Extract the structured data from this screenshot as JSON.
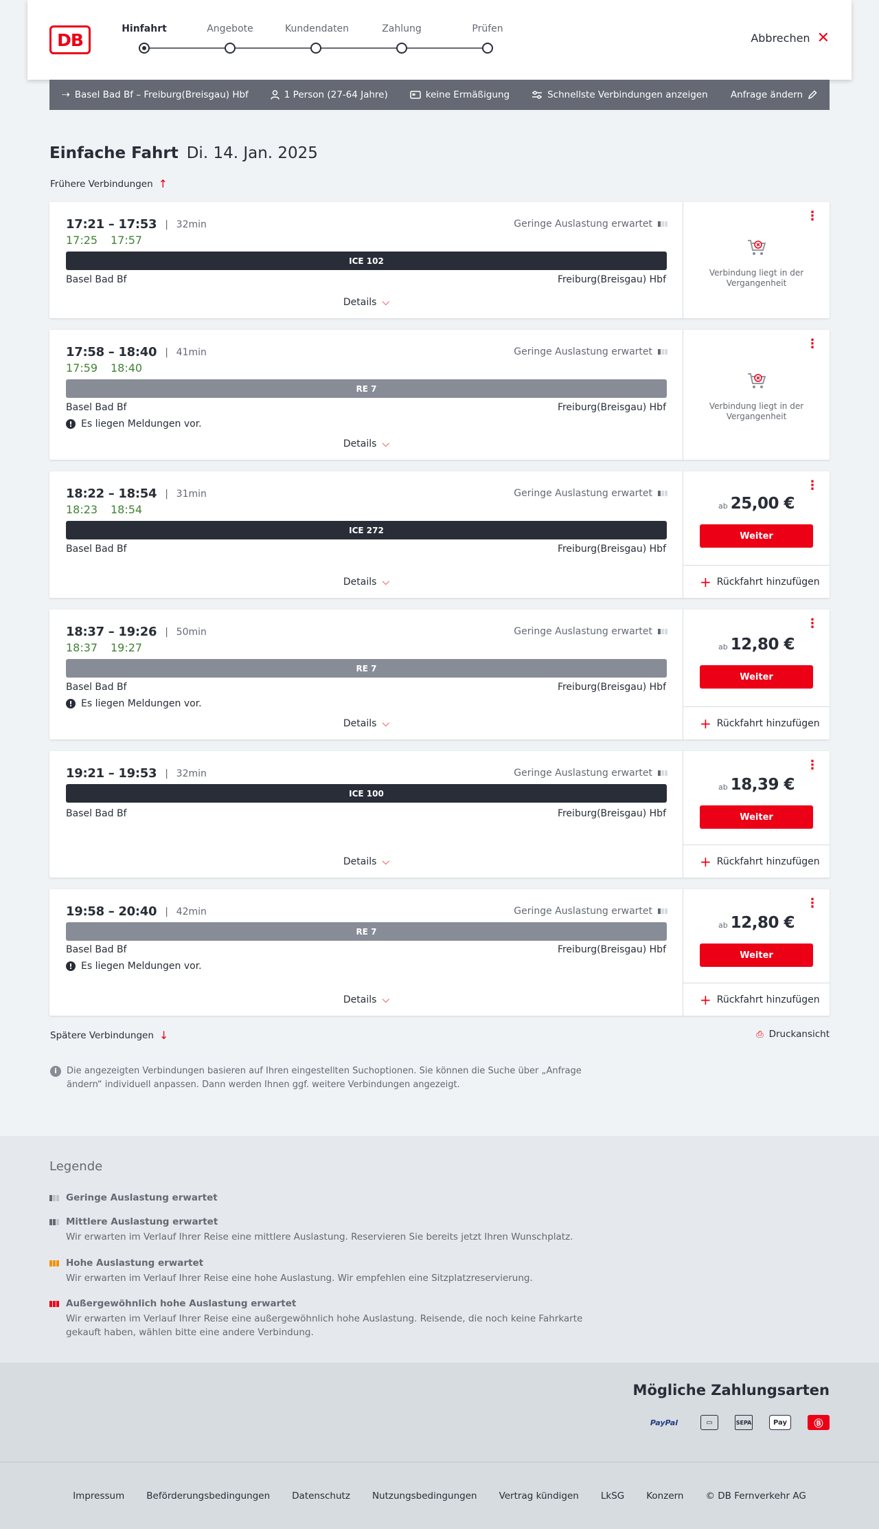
{
  "header": {
    "logo_text": "DB",
    "steps": [
      "Hinfahrt",
      "Angebote",
      "Kundendaten",
      "Zahlung",
      "Prüfen"
    ],
    "active_step": "Hinfahrt",
    "cancel_label": "Abbrechen"
  },
  "query_bar": {
    "route": "Basel Bad Bf – Freiburg(Breisgau) Hbf",
    "passengers": "1 Person (27-64 Jahre)",
    "discount": "keine Ermäßigung",
    "fastest": "Schnellste Verbindungen anzeigen",
    "change_label": "Anfrage ändern"
  },
  "title": {
    "type": "Einfache Fahrt",
    "date": "Di. 14. Jan. 2025"
  },
  "earlier_label": "Frühere Verbindungen",
  "later_label": "Spätere Verbindungen",
  "print_label": "Druckansicht",
  "connections": [
    {
      "times": "17:21 – 17:53",
      "duration": "32min",
      "rt_dep": "17:25",
      "rt_arr": "17:57",
      "train": "ICE 102",
      "train_type": "ice",
      "from": "Basel Bad Bf",
      "to": "Freiburg(Breisgau) Hbf",
      "load": "Geringe Auslastung erwartet",
      "message": "",
      "details": "Details",
      "past": "Verbindung liegt in der Vergangenheit"
    },
    {
      "times": "17:58 – 18:40",
      "duration": "41min",
      "rt_dep": "17:59",
      "rt_arr": "18:40",
      "train": "RE 7",
      "train_type": "re",
      "from": "Basel Bad Bf",
      "to": "Freiburg(Breisgau) Hbf",
      "load": "Geringe Auslastung erwartet",
      "message": "Es liegen Meldungen vor.",
      "details": "Details",
      "past": "Verbindung liegt in der Vergangenheit"
    },
    {
      "times": "18:22 – 18:54",
      "duration": "31min",
      "rt_dep": "18:23",
      "rt_arr": "18:54",
      "train": "ICE 272",
      "train_type": "ice",
      "from": "Basel Bad Bf",
      "to": "Freiburg(Breisgau) Hbf",
      "load": "Geringe Auslastung erwartet",
      "message": "",
      "details": "Details",
      "price_prefix": "ab",
      "price": "25,00 €",
      "button": "Weiter",
      "return_label": "Rückfahrt hinzufügen"
    },
    {
      "times": "18:37 – 19:26",
      "duration": "50min",
      "rt_dep": "18:37",
      "rt_arr": "19:27",
      "train": "RE 7",
      "train_type": "re",
      "from": "Basel Bad Bf",
      "to": "Freiburg(Breisgau) Hbf",
      "load": "Geringe Auslastung erwartet",
      "message": "Es liegen Meldungen vor.",
      "details": "Details",
      "price_prefix": "ab",
      "price": "12,80 €",
      "button": "Weiter",
      "return_label": "Rückfahrt hinzufügen"
    },
    {
      "times": "19:21 – 19:53",
      "duration": "32min",
      "train": "ICE 100",
      "train_type": "ice",
      "from": "Basel Bad Bf",
      "to": "Freiburg(Breisgau) Hbf",
      "load": "Geringe Auslastung erwartet",
      "message": "",
      "details": "Details",
      "price_prefix": "ab",
      "price": "18,39 €",
      "button": "Weiter",
      "return_label": "Rückfahrt hinzufügen"
    },
    {
      "times": "19:58 – 20:40",
      "duration": "42min",
      "train": "RE 7",
      "train_type": "re",
      "from": "Basel Bad Bf",
      "to": "Freiburg(Breisgau) Hbf",
      "load": "Geringe Auslastung erwartet",
      "message": "Es liegen Meldungen vor.",
      "details": "Details",
      "price_prefix": "ab",
      "price": "12,80 €",
      "button": "Weiter",
      "return_label": "Rückfahrt hinzufügen"
    }
  ],
  "info_text": "Die angezeigten Verbindungen basieren auf Ihren eingestellten Suchoptionen. Sie können die Suche über „Anfrage ändern“ individuell anpassen. Dann werden Ihnen ggf. weitere Verbindungen angezeigt.",
  "legend": {
    "title": "Legende",
    "items": [
      {
        "label": "Geringe Auslastung erwartet",
        "desc": ""
      },
      {
        "label": "Mittlere Auslastung erwartet",
        "desc": "Wir erwarten im Verlauf Ihrer Reise eine mittlere Auslastung. Reservieren Sie bereits jetzt Ihren Wunschplatz."
      },
      {
        "label": "Hohe Auslastung erwartet",
        "desc": "Wir erwarten im Verlauf Ihrer Reise eine hohe Auslastung. Wir empfehlen eine Sitzplatzreservierung."
      },
      {
        "label": "Außergewöhnlich hohe Auslastung erwartet",
        "desc": "Wir erwarten im Verlauf Ihrer Reise eine außergewöhnlich hohe Auslastung. Reisende, die noch keine Fahrkarte gekauft haben, wählen bitte eine andere Verbindung."
      }
    ]
  },
  "payment": {
    "title": "Mögliche Zahlungsarten",
    "methods": [
      "paypal-icon",
      "credit-card-icon",
      "sepa-icon",
      "apple-pay-icon",
      "db-card-icon"
    ],
    "paypal_text": "PayPal",
    "apple_text": "Pay",
    "sepa_text": "SEPA"
  },
  "footer": {
    "links": [
      "Impressum",
      "Beförderungsbedingungen",
      "Datenschutz",
      "Nutzungsbedingungen",
      "Vertrag kündigen",
      "LkSG",
      "Konzern",
      "© DB Fernverkehr AG"
    ]
  },
  "colors": {
    "brand_red": "#ec0016",
    "realtime_green": "#408335",
    "ice_bar": "#282d37",
    "re_bar": "#878c96"
  }
}
